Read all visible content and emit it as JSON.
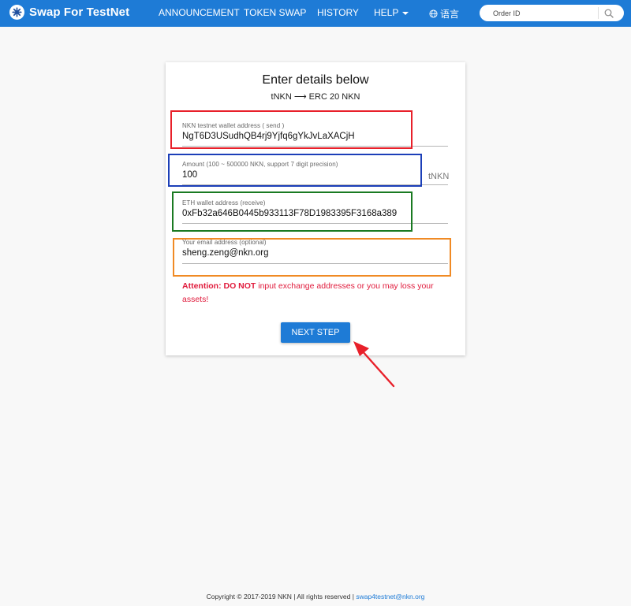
{
  "header": {
    "title": "Swap For TestNet",
    "logo": "nkn-logo-icon",
    "nav": [
      {
        "label": "ANNOUNCEMENT"
      },
      {
        "label": "TOKEN SWAP"
      },
      {
        "label": "HISTORY"
      },
      {
        "label": "HELP"
      },
      {
        "label": "语言"
      }
    ],
    "search_placeholder": "Order ID",
    "accent_color": "#1e7bd6"
  },
  "form": {
    "title": "Enter details below",
    "subtitle": "tNKN ⟶ ERC 20 NKN",
    "fields": [
      {
        "label": "NKN testnet wallet address ( send )",
        "value": "NgT6D3USudhQB4rj9Yjfq6gYkJvLaXACjH",
        "highlight": "#e8202a"
      },
      {
        "label": "Amount (100 ~ 500000 NKN, support 7 digit precision)",
        "value": "100",
        "unit": "tNKN",
        "highlight": "#1c3fb8"
      },
      {
        "label": "ETH wallet address (receive)",
        "value": "0xFb32a646B0445b933113F78D1983395F3168a389",
        "highlight": "#1a7a22"
      },
      {
        "label": "Your email address (optional)",
        "value": "sheng.zeng@nkn.org",
        "highlight": "#f08a24"
      }
    ],
    "attention_bold": "Attention: DO NOT",
    "attention_text": " input exchange addresses or you may loss your assets!",
    "attention_color": "#e01b3c",
    "next_label": "NEXT STEP"
  },
  "footer": {
    "text": "Copyright © 2017-2019 NKN | All rights reserved | ",
    "email": "swap4testnet@nkn.org"
  }
}
